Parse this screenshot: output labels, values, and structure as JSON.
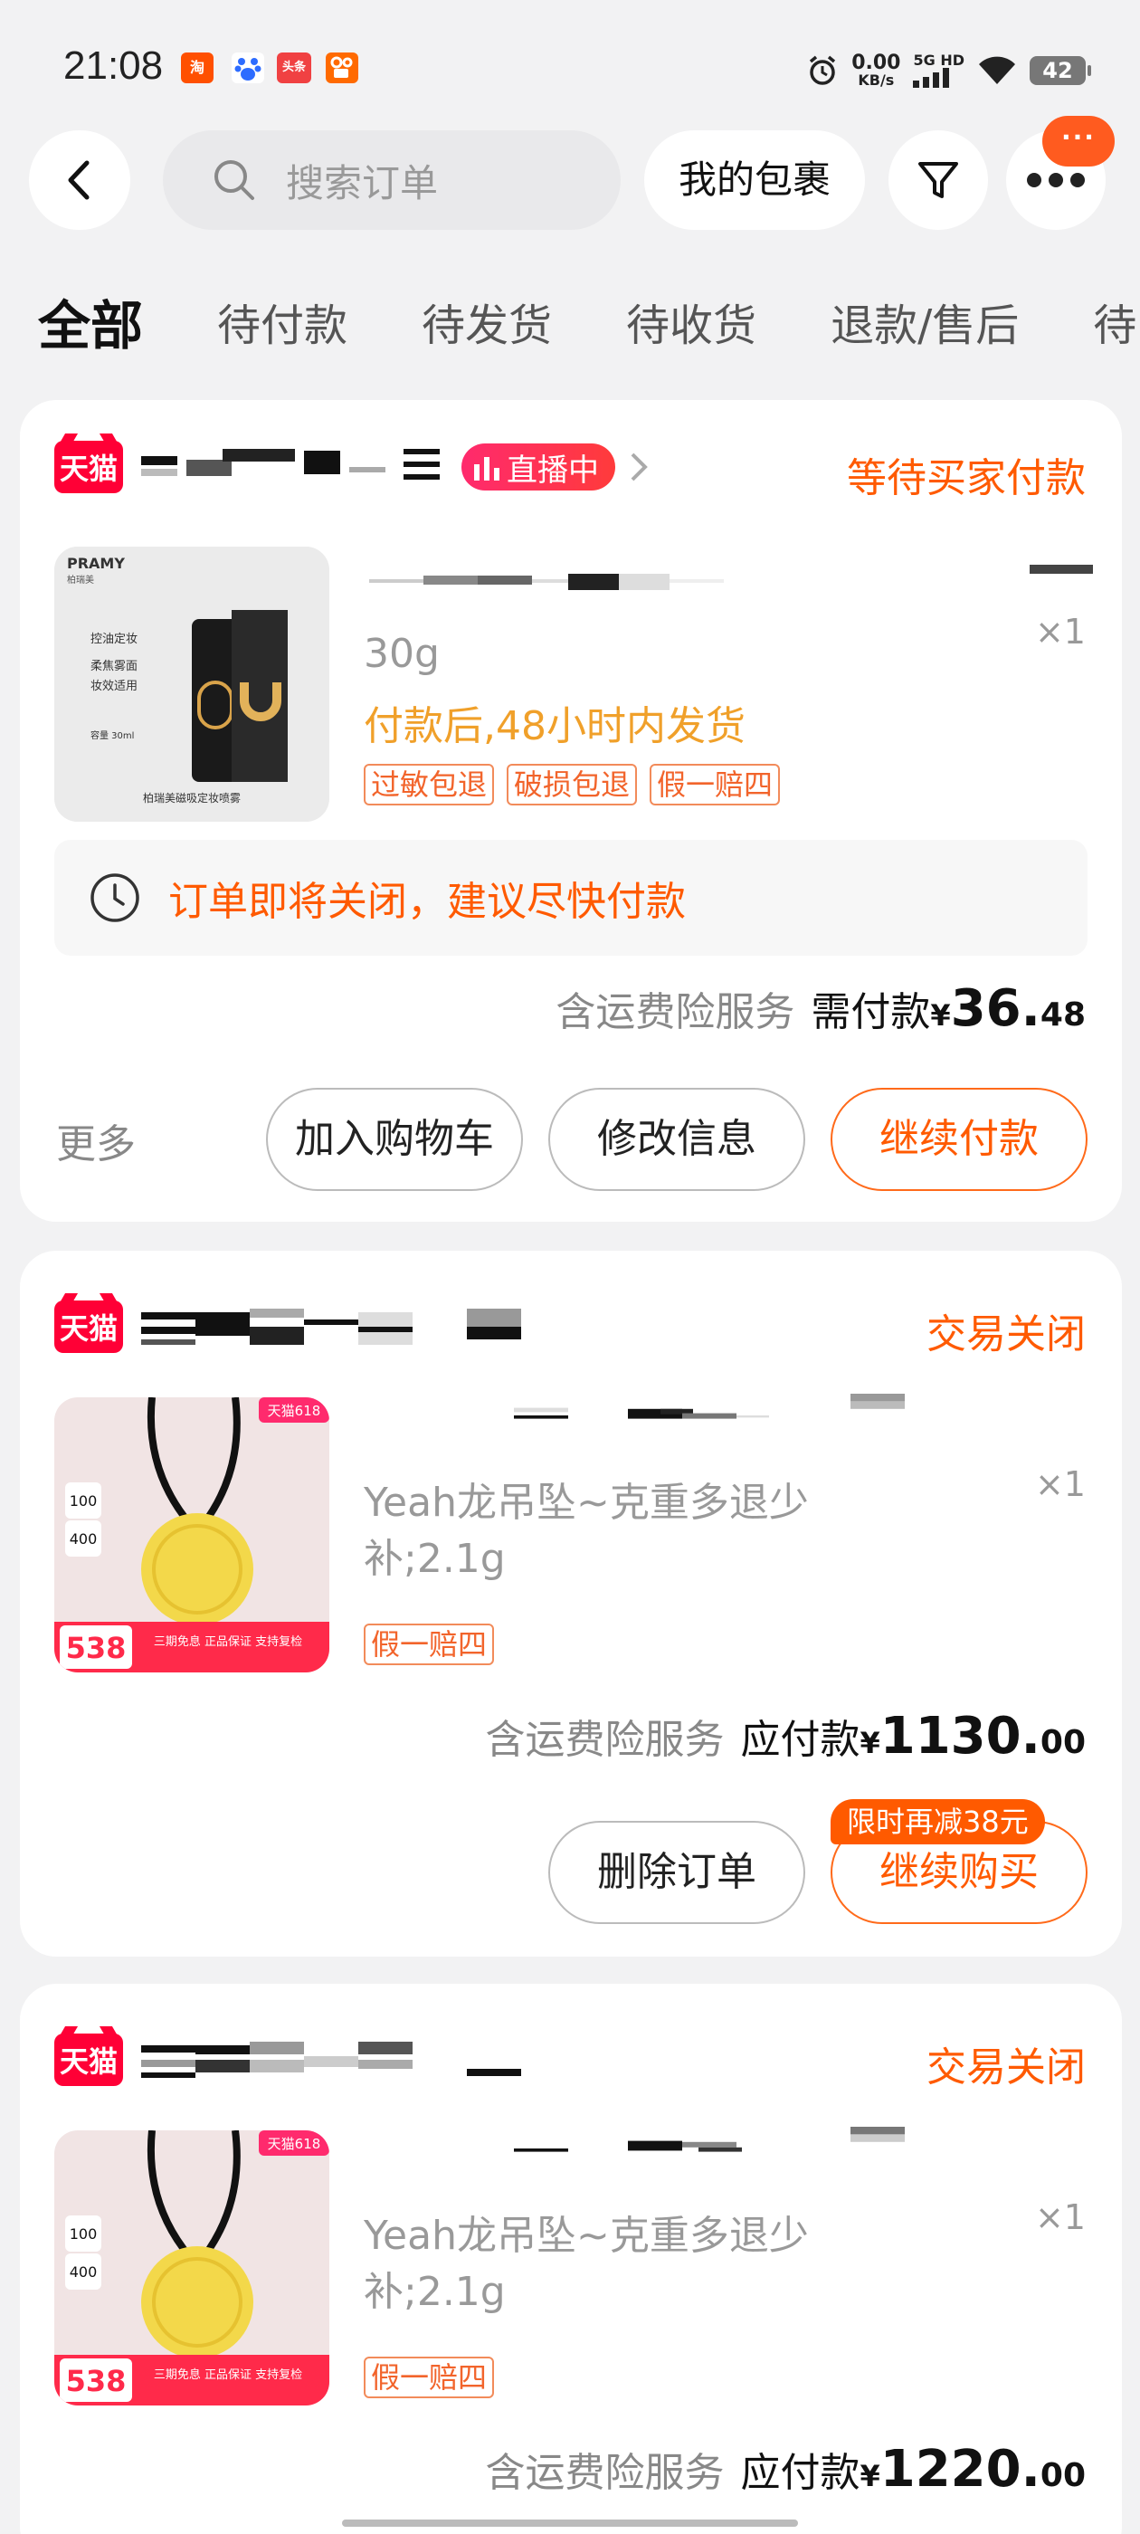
{
  "status_bar": {
    "time": "21:08",
    "apps": [
      {
        "icon": "taobao-icon",
        "label": "淘",
        "color": "#ff5000"
      },
      {
        "icon": "baidu-icon",
        "label": "",
        "color": "#2d6cff"
      },
      {
        "icon": "toutiao-icon",
        "label": "头条",
        "color": "#f04142"
      },
      {
        "icon": "kuaishou-icon",
        "label": "",
        "color": "#ff6a00"
      }
    ],
    "net_speed": "0.00",
    "net_unit": "KB/s",
    "network": "5G HD",
    "battery": "42"
  },
  "topbar": {
    "search_placeholder": "搜索订单",
    "packages_label": "我的包裹",
    "message_badge": "···"
  },
  "tabs": [
    {
      "label": "全部",
      "active": true
    },
    {
      "label": "待付款",
      "active": false
    },
    {
      "label": "待发货",
      "active": false
    },
    {
      "label": "待收货",
      "active": false
    },
    {
      "label": "退款/售后",
      "active": false
    },
    {
      "label": "待",
      "active": false
    }
  ],
  "orders": [
    {
      "shop_badge": "天猫",
      "live_badge": "直播中",
      "status": "等待买家付款",
      "product": {
        "thumb_brand": "PRAMY",
        "thumb_brand_cn": "柏瑞美",
        "thumb_lines": [
          "控油定妆",
          "柔焦雾面",
          "妆效适用"
        ],
        "thumb_volume": "容量 30ml",
        "thumb_caption": "柏瑞美磁吸定妆喷雾",
        "spec": "30g",
        "ship_note": "付款后,48小时内发货",
        "quantity": "×1",
        "tags": [
          "过敏包退",
          "破损包退",
          "假一赔四"
        ]
      },
      "notice": "订单即将关闭，建议尽快付款",
      "price": {
        "service": "含运费险服务",
        "label": "需付款",
        "yen": "¥",
        "int": "36.",
        "dec": "48"
      },
      "more_label": "更多",
      "buttons": [
        "加入购物车",
        "修改信息",
        "继续付款"
      ]
    },
    {
      "shop_badge": "天猫",
      "status": "交易关闭",
      "product": {
        "thumb_corner": "天猫618",
        "thumb_badges": [
          "100",
          "400"
        ],
        "thumb_price": "538",
        "thumb_banner": "三期免息 正品保证 支持复检",
        "spec": "Yeah龙吊坠~克重多退少补;2.1g",
        "quantity": "×1",
        "tags": [
          "假一赔四"
        ]
      },
      "price": {
        "service": "含运费险服务",
        "label": "应付款",
        "yen": "¥",
        "int": "1130.",
        "dec": "00"
      },
      "promo": "限时再减38元",
      "buttons": [
        "删除订单",
        "继续购买"
      ]
    },
    {
      "shop_badge": "天猫",
      "status": "交易关闭",
      "product": {
        "thumb_corner": "天猫618",
        "thumb_badges": [
          "100",
          "400"
        ],
        "thumb_price": "538",
        "thumb_banner": "三期免息 正品保证 支持复检",
        "spec": "Yeah龙吊坠~克重多退少补;2.1g",
        "quantity": "×1",
        "tags": [
          "假一赔四"
        ]
      },
      "price": {
        "service": "含运费险服务",
        "label": "应付款",
        "yen": "¥",
        "int": "1220.",
        "dec": "00"
      }
    }
  ]
}
